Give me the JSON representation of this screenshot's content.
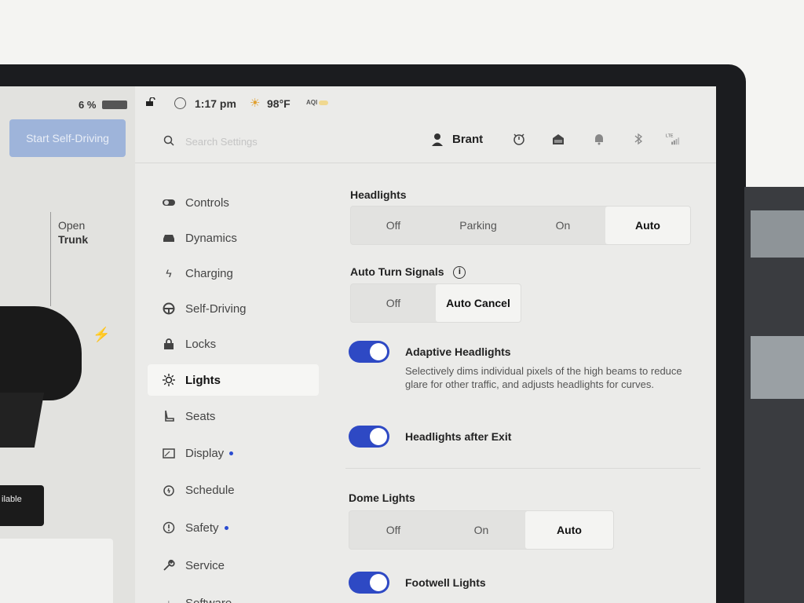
{
  "status": {
    "battery_percent": "6 %",
    "time": "1:17 pm",
    "temperature": "98°F",
    "aqi_label": "AQI"
  },
  "car": {
    "self_driving_button": "Start Self-Driving",
    "open_label": "Open",
    "trunk_label": "Trunk",
    "available_label": "ilable"
  },
  "header": {
    "search_placeholder": "Search Settings",
    "user_name": "Brant"
  },
  "nav": {
    "items": [
      {
        "label": "Controls",
        "icon": "toggle-icon"
      },
      {
        "label": "Dynamics",
        "icon": "car-icon"
      },
      {
        "label": "Charging",
        "icon": "bolt-icon"
      },
      {
        "label": "Self-Driving",
        "icon": "steering-wheel-icon"
      },
      {
        "label": "Locks",
        "icon": "lock-icon"
      },
      {
        "label": "Lights",
        "icon": "light-icon",
        "active": true
      },
      {
        "label": "Seats",
        "icon": "seat-icon"
      },
      {
        "label": "Display",
        "icon": "display-icon",
        "dot": true
      },
      {
        "label": "Schedule",
        "icon": "schedule-icon"
      },
      {
        "label": "Safety",
        "icon": "safety-icon",
        "dot": true
      },
      {
        "label": "Service",
        "icon": "wrench-icon"
      },
      {
        "label": "Software",
        "icon": "download-icon"
      }
    ]
  },
  "lights": {
    "headlights": {
      "title": "Headlights",
      "options": [
        "Off",
        "Parking",
        "On",
        "Auto"
      ],
      "selected": "Auto"
    },
    "auto_turn_signals": {
      "title": "Auto Turn Signals",
      "options": [
        "Off",
        "Auto Cancel"
      ],
      "selected": "Auto Cancel"
    },
    "adaptive_headlights": {
      "label": "Adaptive Headlights",
      "description": "Selectively dims individual pixels of the high beams to reduce glare for other traffic, and adjusts headlights for curves.",
      "on": true
    },
    "headlights_after_exit": {
      "label": "Headlights after Exit",
      "on": true
    },
    "dome_lights": {
      "title": "Dome Lights",
      "options": [
        "Off",
        "On",
        "Auto"
      ],
      "selected": "Auto"
    },
    "footwell_lights": {
      "label": "Footwell Lights",
      "on": true
    }
  },
  "colors": {
    "accent": "#2e49c4",
    "toggle_on": "#2e49c4",
    "nav_dot": "#2a4bd0"
  }
}
